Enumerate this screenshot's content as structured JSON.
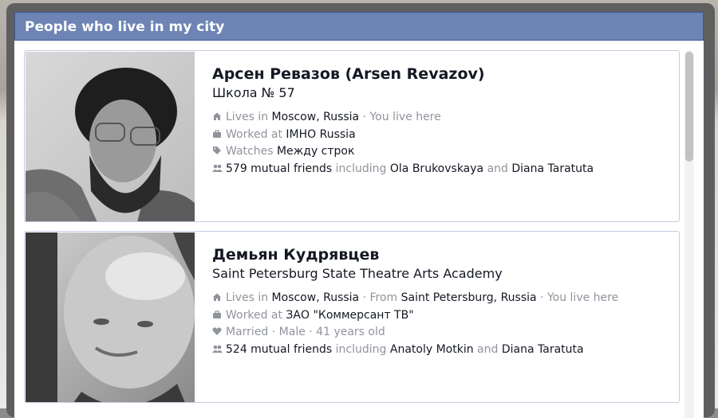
{
  "dialog": {
    "title": "People who live in my city"
  },
  "people": [
    {
      "name": "Арсен Ревазов (Arsen Revazov)",
      "subtitle": "Школа № 57",
      "details": [
        {
          "icon": "house-icon",
          "parts": [
            {
              "t": "Lives in ",
              "m": true
            },
            {
              "t": "Moscow, Russia",
              "m": false
            },
            {
              "t": " · You live here",
              "m": true
            }
          ]
        },
        {
          "icon": "briefcase-icon",
          "parts": [
            {
              "t": "Worked at ",
              "m": true
            },
            {
              "t": "IMHO Russia",
              "m": false
            }
          ]
        },
        {
          "icon": "tag-icon",
          "parts": [
            {
              "t": "Watches ",
              "m": true
            },
            {
              "t": "Между строк",
              "m": false
            }
          ]
        },
        {
          "icon": "friends-icon",
          "parts": [
            {
              "t": "579 mutual friends",
              "m": false
            },
            {
              "t": " including ",
              "m": true
            },
            {
              "t": "Ola Brukovskaya",
              "m": false
            },
            {
              "t": " and ",
              "m": true
            },
            {
              "t": "Diana Taratuta",
              "m": false
            }
          ]
        }
      ]
    },
    {
      "name": "Демьян Кудрявцев",
      "subtitle": "Saint Petersburg State Theatre Arts Academy",
      "details": [
        {
          "icon": "house-icon",
          "parts": [
            {
              "t": "Lives in ",
              "m": true
            },
            {
              "t": "Moscow, Russia",
              "m": false
            },
            {
              "t": " · From ",
              "m": true
            },
            {
              "t": "Saint Petersburg, Russia",
              "m": false
            },
            {
              "t": " · You live here",
              "m": true
            }
          ]
        },
        {
          "icon": "briefcase-icon",
          "parts": [
            {
              "t": "Worked at ",
              "m": true
            },
            {
              "t": "ЗАО \"Коммерсант ТВ\"",
              "m": false
            }
          ]
        },
        {
          "icon": "heart-icon",
          "parts": [
            {
              "t": "Married · Male · 41 years old",
              "m": true
            }
          ]
        },
        {
          "icon": "friends-icon",
          "parts": [
            {
              "t": "524 mutual friends",
              "m": false
            },
            {
              "t": " including ",
              "m": true
            },
            {
              "t": "Anatoly Motkin",
              "m": false
            },
            {
              "t": " and ",
              "m": true
            },
            {
              "t": "Diana Taratuta",
              "m": false
            }
          ]
        }
      ]
    }
  ]
}
